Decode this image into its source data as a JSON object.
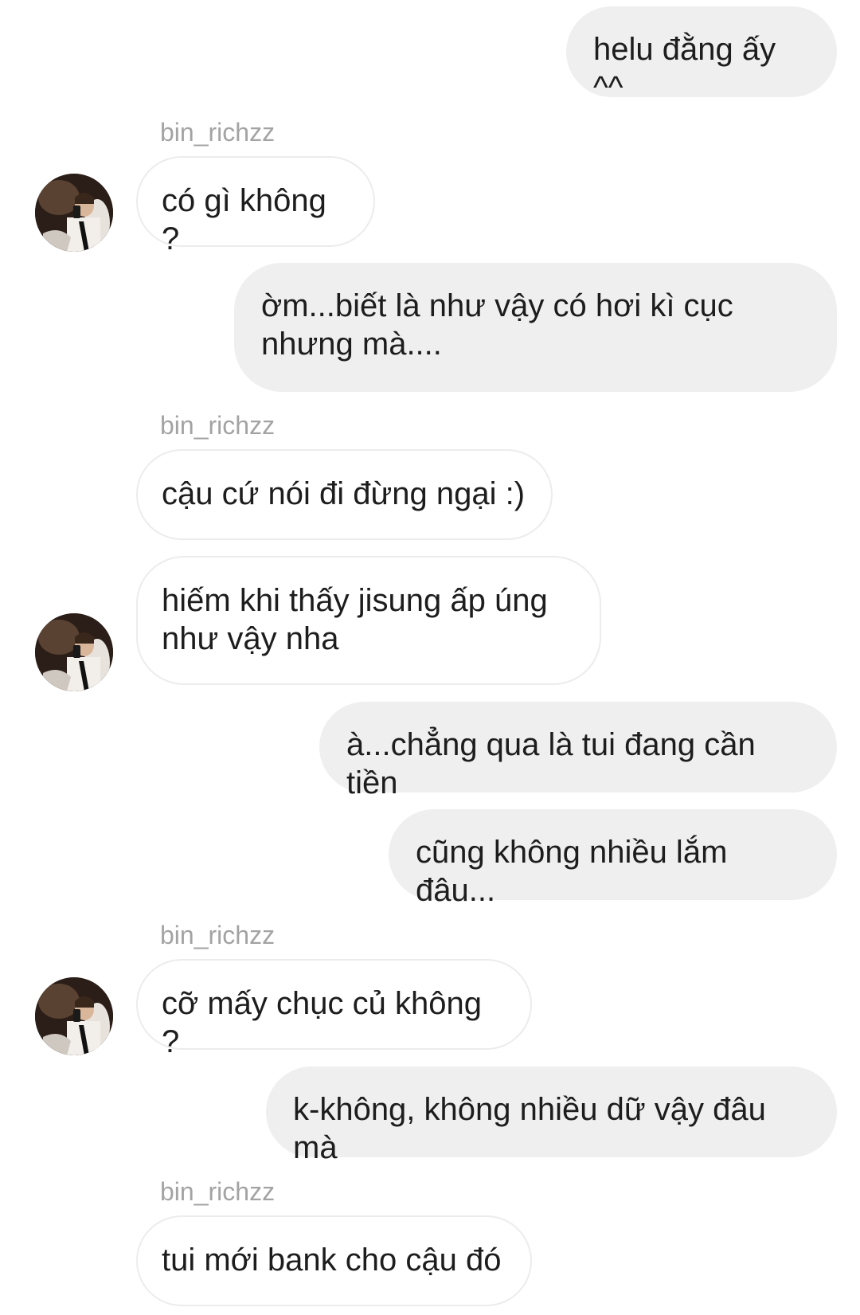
{
  "contact": {
    "username": "bin_richzz"
  },
  "messages": [
    {
      "sender": "me",
      "text": "helu đằng ấy ^^"
    },
    {
      "sender": "them",
      "text": "có gì không ?"
    },
    {
      "sender": "me",
      "text": "ờm...biết là như vậy có hơi kì cục\nnhưng mà...."
    },
    {
      "sender": "them",
      "text": "cậu cứ nói đi đừng ngại :)"
    },
    {
      "sender": "them",
      "text": "hiếm khi thấy jisung ấp úng\nnhư vậy nha"
    },
    {
      "sender": "me",
      "text": "à...chẳng qua là tui đang cần tiền"
    },
    {
      "sender": "me",
      "text": "cũng không nhiều lắm đâu..."
    },
    {
      "sender": "them",
      "text": "cỡ mấy chục củ không ?"
    },
    {
      "sender": "me",
      "text": "k-không, không nhiều dữ vậy đâu mà"
    },
    {
      "sender": "them",
      "text": "tui mới bank cho cậu đó"
    }
  ],
  "colors": {
    "outgoing_bubble": "#efefef",
    "incoming_bubble": "#ffffff",
    "incoming_border": "#ececec",
    "username_text": "#a3a3a3"
  }
}
